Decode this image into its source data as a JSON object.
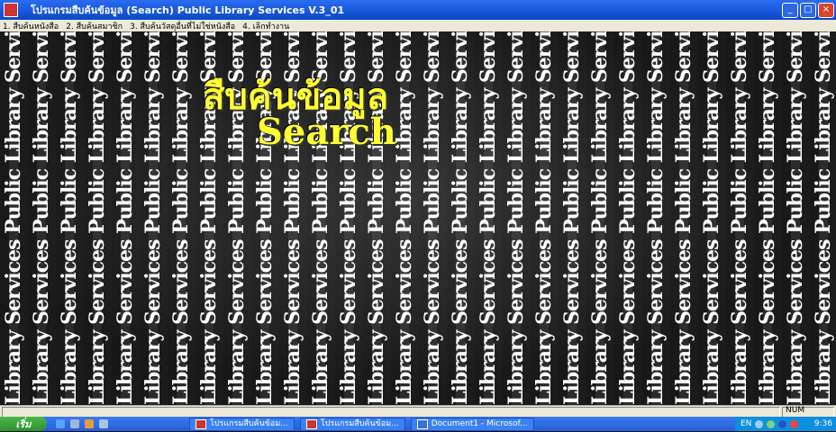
{
  "window": {
    "title": "โปรแกรมสืบค้นข้อมูล (Search)  Public Library Services V.3_01",
    "controls": {
      "minimize": "_",
      "maximize": "□",
      "close": "×"
    }
  },
  "menu": {
    "items": [
      {
        "label": "1. สืบค้นหนังสือ"
      },
      {
        "label": "2. สืบค้นสมาชิก"
      },
      {
        "label": "3. สืบค้นวัสดุอื่นที่ไม่ใช่หนังสือ"
      },
      {
        "label": "4. เลิกทำงาน"
      }
    ]
  },
  "content": {
    "heading_thai": "สืบค้นข้อมูล",
    "heading_en": "Search",
    "background_text": "Library Services Public Library Services Public Library Services Public Library Services"
  },
  "status": {
    "num": "NUM"
  },
  "taskbar": {
    "start_label": "เริ่ม",
    "tasks": [
      {
        "label": "โปรแกรมสืบค้นข้อม..."
      },
      {
        "label": "โปรแกรมสืบค้นข้อม..."
      },
      {
        "label": "Document1 - Microsof..."
      }
    ],
    "tray": {
      "lang": "EN",
      "time": "9:36"
    }
  },
  "colors": {
    "heading": "#ffff33",
    "titlebar": "#0b48c8",
    "taskbar": "#245edb"
  }
}
